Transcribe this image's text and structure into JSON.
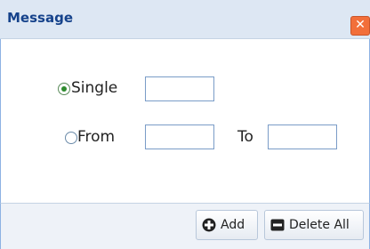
{
  "window": {
    "title": "Message",
    "close_glyph": "✕"
  },
  "form": {
    "single_label": "Single",
    "single_value": "",
    "from_label": "From",
    "from_value": "",
    "to_label": "To",
    "to_value": "",
    "selected_option": "single"
  },
  "footer": {
    "add_label": "Add",
    "delete_all_label": "Delete All",
    "add_icon": "plus-circle-icon",
    "delete_icon": "minus-box-icon"
  },
  "colors": {
    "title_text": "#15428b",
    "close_button": "#f26f3a",
    "radio_selected": "#2e8b2e"
  }
}
